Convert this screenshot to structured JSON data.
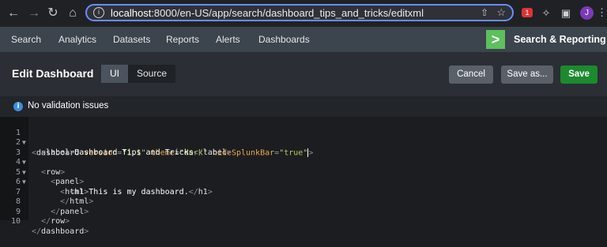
{
  "browser": {
    "url_host": "localhost",
    "url_rest": ":8000/en-US/app/search/dashboard_tips_and_tricks/editxml",
    "avatar_initial": "J",
    "ext_badge": "1"
  },
  "appnav": {
    "items": [
      "Search",
      "Analytics",
      "Datasets",
      "Reports",
      "Alerts",
      "Dashboards"
    ],
    "logo_glyph": ">",
    "app_name": "Search & Reporting"
  },
  "editbar": {
    "title": "Edit Dashboard",
    "modes": [
      "UI",
      "Source"
    ],
    "active_mode": "UI",
    "cancel": "Cancel",
    "save_as": "Save as...",
    "save": "Save"
  },
  "validation": {
    "message": "No validation issues"
  },
  "editor": {
    "lines": [
      {
        "n": "1",
        "fold": true
      },
      {
        "n": "2",
        "fold": false
      },
      {
        "n": "3",
        "fold": true
      },
      {
        "n": "4",
        "fold": true
      },
      {
        "n": "5",
        "fold": true
      },
      {
        "n": "6",
        "fold": false
      },
      {
        "n": "7",
        "fold": false
      },
      {
        "n": "8",
        "fold": false
      },
      {
        "n": "9",
        "fold": false
      },
      {
        "n": "10",
        "fold": false
      }
    ],
    "tokens": {
      "dashboard": "dashboard",
      "version_attr": "version",
      "version_val": "\"1.1\"",
      "theme_attr": "theme",
      "theme_val": "\"dark\"",
      "hide_attr": "hideSplunkBar",
      "hide_val": "\"true\"",
      "label": "label",
      "label_text": "Dashboard Tips and Tricks",
      "row": "row",
      "panel": "panel",
      "html": "html",
      "h1": "h1",
      "h1_text": "This is my dashboard."
    }
  },
  "colors": {
    "accent_blue": "#6b8cff",
    "save_green": "#1c8a2e",
    "logo_green": "#5cc05c",
    "attr_orange": "#e8a94a",
    "value_green": "#b9c95e"
  }
}
